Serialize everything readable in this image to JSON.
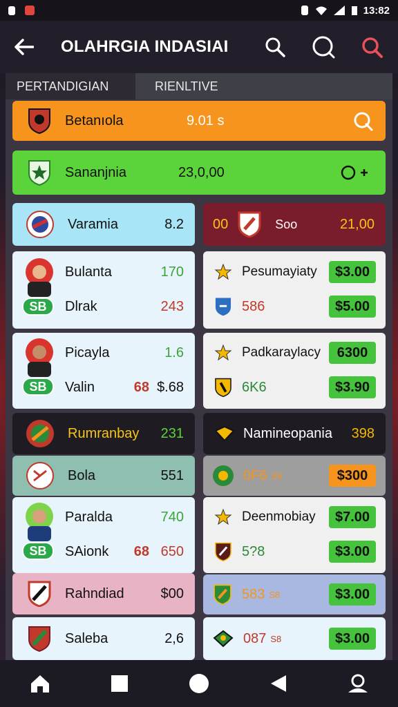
{
  "status_bar": {
    "time": "13:82"
  },
  "header": {
    "title": "OLAHRGIA INDASIAI"
  },
  "tabs": [
    {
      "label": "PERTANDIGIAN"
    },
    {
      "label": "RIENLTIVE"
    }
  ],
  "rows": {
    "r1": {
      "name": "Betanıola",
      "value": "9.01 s",
      "color": "#f7941d"
    },
    "r2": {
      "name": "Sananjnia",
      "value": "23,0,00",
      "color": "#5ad43a"
    }
  },
  "left": {
    "varamia": {
      "name": "Varamia",
      "value": "8.2",
      "color": "#a8e6f7"
    },
    "card1": {
      "line1_name": "Bulanta",
      "line1_value": "170",
      "line2_name": "Dlrak",
      "line2_value": "243",
      "badge": "SB",
      "color": "#e8f4fb"
    },
    "card2": {
      "line1_name": "Picayla",
      "line1_value": "1.6",
      "line2_name": "Valin",
      "line2_odds": "68",
      "line2_value": "$.68",
      "badge": "SB",
      "color": "#e8f4fb"
    },
    "section": {
      "name": "Rumranbay",
      "value": "231",
      "color": "#1e1b22"
    },
    "bola": {
      "name": "Bola",
      "value": "551",
      "color": "#8fbfb0"
    },
    "card3": {
      "line1_name": "Paralda",
      "line1_value": "740",
      "line2_name": "SAionk",
      "line2_odds": "68",
      "line2_value": "650",
      "badge": "SB",
      "color": "#e8f4fb"
    },
    "rahndiad": {
      "name": "Rahndiad",
      "value": "$00",
      "color": "#e8b3c4"
    },
    "saleba": {
      "name": "Saleba",
      "value": "2,6",
      "color": "#e8f4fb"
    }
  },
  "right": {
    "header": {
      "left_text": "00",
      "name": "Soo",
      "value": "21,00",
      "color": "#7b1c2c"
    },
    "card1": {
      "line1_name": "Pesumayiaty",
      "line1_price": "$3.00",
      "line2_value": "586",
      "line2_price": "$5.00",
      "color": "#f0f0f0"
    },
    "card2": {
      "line1_name": "Padkaraylacy",
      "line1_price": "6300",
      "line2_value": "6K6",
      "line2_price": "$3.90",
      "color": "#f0f0f0"
    },
    "section": {
      "name": "Namineopania",
      "value": "398",
      "color": "#1e1b22"
    },
    "r_odds": {
      "value": "0F6",
      "sup": "S8",
      "price": "$300",
      "color": "#9e9e9e"
    },
    "card3": {
      "line1_name": "Deenmobiay",
      "line1_price": "$7.00",
      "line2_value": "5?8",
      "line2_price": "$3.00",
      "color": "#f0f0f0"
    },
    "r_blue": {
      "value": "583",
      "sup": "S8",
      "price": "$3.00",
      "color": "#a9b8e0"
    },
    "r_last": {
      "value": "087",
      "sup": "S8",
      "price": "$3.00",
      "color": "#e8f4fb"
    }
  },
  "colors": {
    "accent_green": "#46c33c",
    "accent_orange": "#f7941d",
    "brand_red": "#c0392b"
  }
}
